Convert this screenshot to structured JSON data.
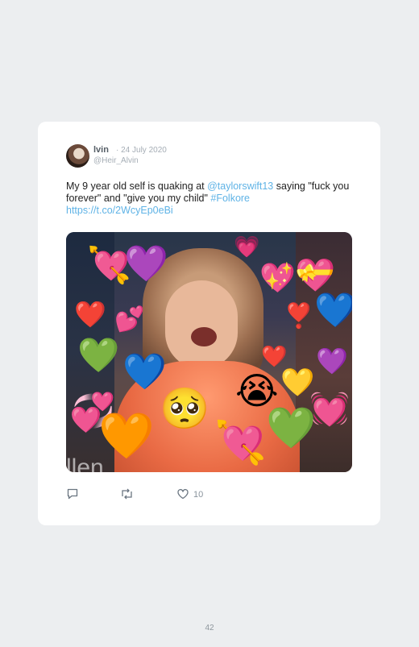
{
  "tweet": {
    "display_name": "lvin",
    "date": "· 24 July 2020",
    "handle": "@Heir_Alvin",
    "text_1": "My 9 year old self is quaking at ",
    "mention": "@taylorswift13",
    "text_2": " saying \"fuck you forever\" and \"give you my child\" ",
    "hashtag": "#Folkore",
    "url": "https://t.co/2WcyEp0eBi",
    "media_watermark": "llen",
    "like_count": "10"
  },
  "icons": {
    "reply": "speech-bubble-icon",
    "retweet": "retweet-arrows-icon",
    "like": "heart-outline-icon"
  },
  "emojis": [
    {
      "glyph": "💘"
    },
    {
      "glyph": "💜"
    },
    {
      "glyph": "💗"
    },
    {
      "glyph": "💖"
    },
    {
      "glyph": "💝"
    },
    {
      "glyph": "❤️"
    },
    {
      "glyph": "💕"
    },
    {
      "glyph": "❣️"
    },
    {
      "glyph": "💙"
    },
    {
      "glyph": "💚"
    },
    {
      "glyph": "💙"
    },
    {
      "glyph": "❤️"
    },
    {
      "glyph": "💜"
    },
    {
      "glyph": "💛"
    },
    {
      "glyph": "😭"
    },
    {
      "glyph": "💞"
    },
    {
      "glyph": "🥺"
    },
    {
      "glyph": "💓"
    },
    {
      "glyph": "🧡"
    },
    {
      "glyph": "💘"
    },
    {
      "glyph": "💚"
    }
  ],
  "page": {
    "number": "42"
  },
  "colors": {
    "link": "#5fb3e6",
    "background": "#eceef0",
    "card": "#ffffff"
  }
}
